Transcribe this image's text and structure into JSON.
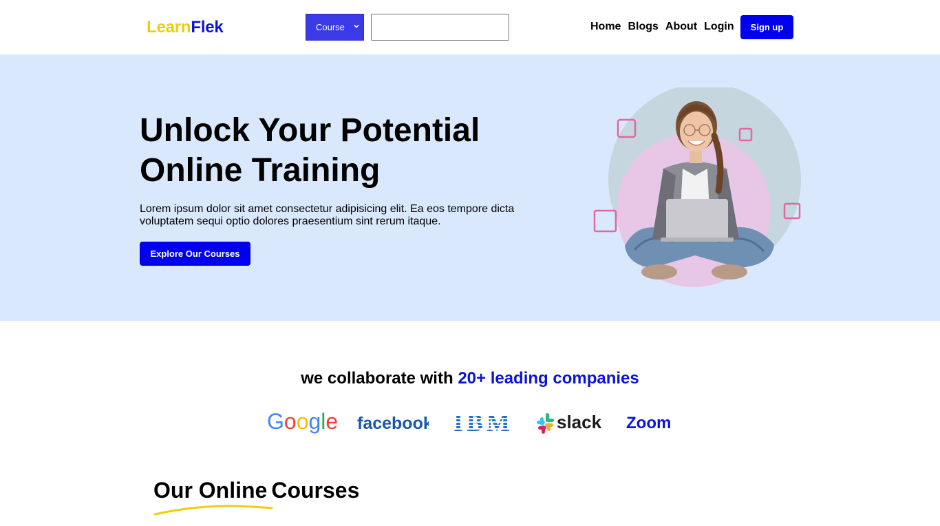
{
  "header": {
    "logo_part1": "Learn",
    "logo_part2": "Flek",
    "course_select_value": "Course",
    "search_value": "",
    "nav": [
      "Home",
      "Blogs",
      "About",
      "Login"
    ],
    "signup_label": "Sign up"
  },
  "hero": {
    "title_line1": "Unlock Your Potential",
    "title_line2": "Online Training",
    "description_line1": "Lorem ipsum dolor sit amet consectetur adipisicing elit. Ea eos tempore dicta",
    "description_line2": "voluptatem sequi optio dolores praesentium sint rerum itaque.",
    "cta_label": "Explore Our Courses",
    "image_icon": "student-with-laptop-illustration"
  },
  "partners": {
    "heading_prefix": "we collaborate with",
    "heading_highlight": "20+ leading companies",
    "logos": [
      {
        "name": "Google",
        "icon": "google-logo"
      },
      {
        "name": "facebook",
        "icon": "facebook-logo"
      },
      {
        "name": "IBM",
        "icon": "ibm-logo"
      },
      {
        "name": "slack",
        "icon": "slack-logo"
      },
      {
        "name": "Zoom",
        "icon": "zoom-logo"
      }
    ]
  },
  "courses": {
    "title_part1": "Our Online",
    "title_part2": "Courses"
  },
  "colors": {
    "brand_yellow": "#f2cc0c",
    "brand_blue": "#0b13d8",
    "button_blue": "#0000ee",
    "hero_bg": "#dae8fd"
  }
}
